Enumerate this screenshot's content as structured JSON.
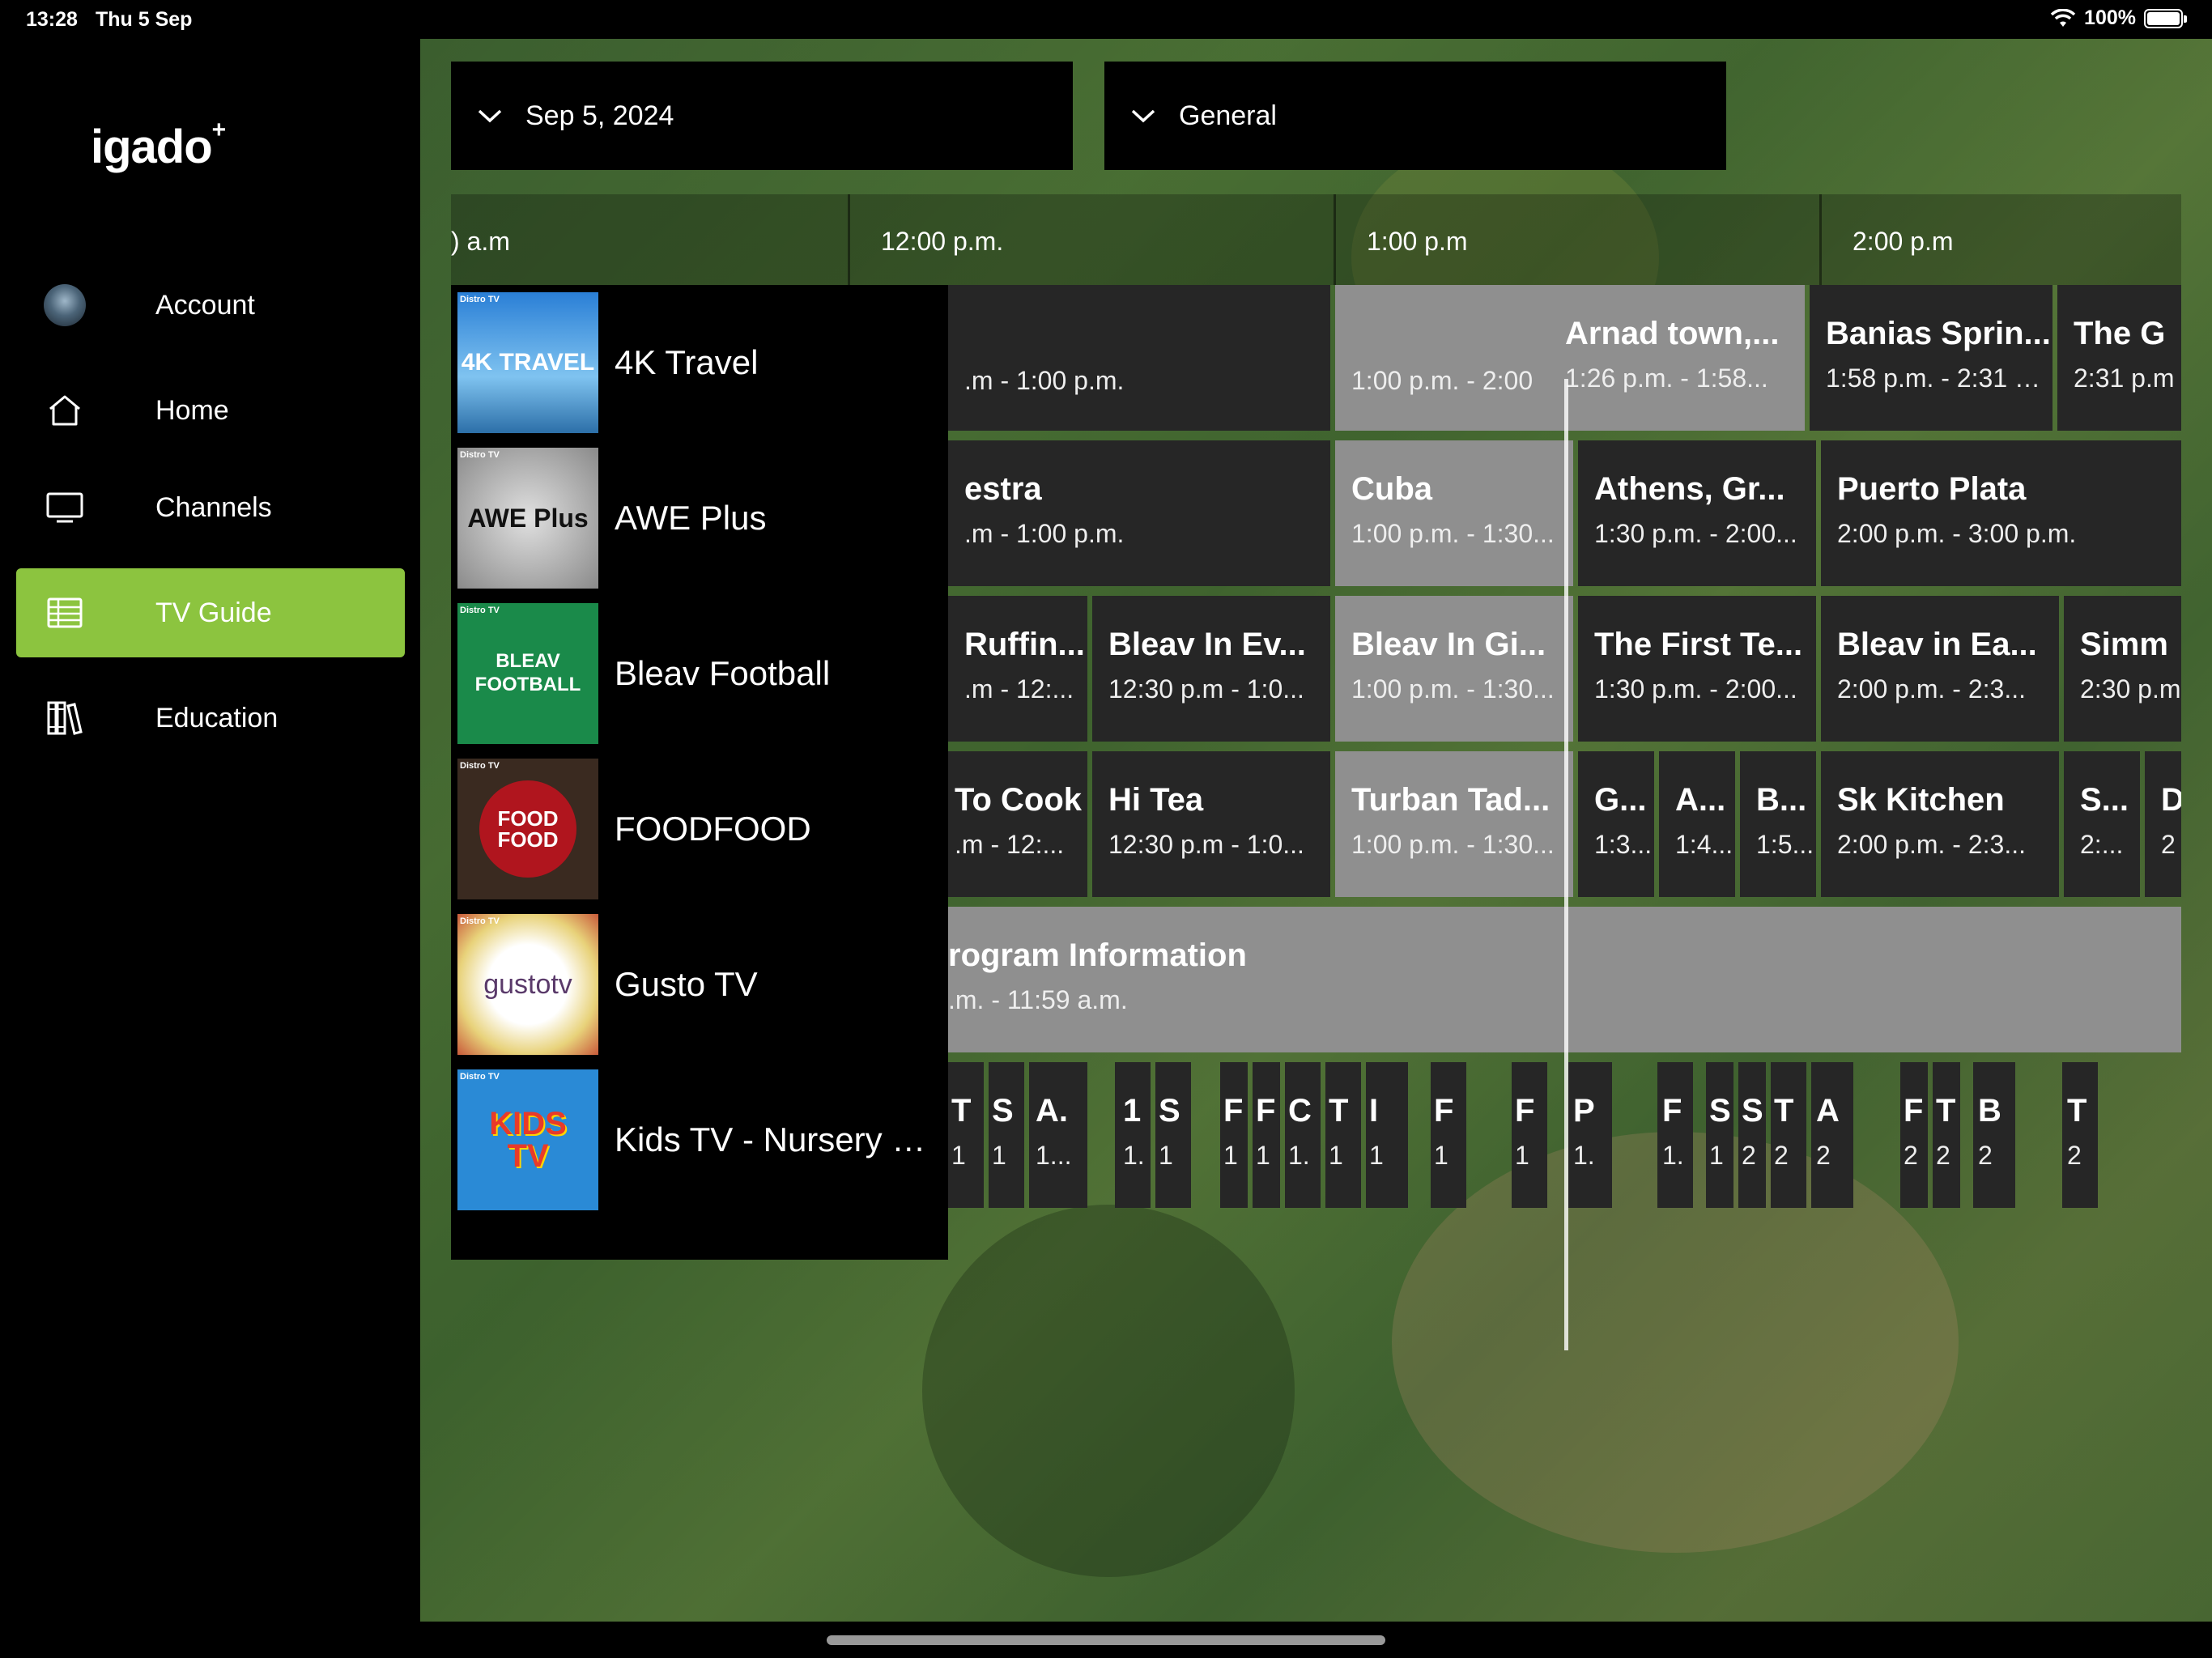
{
  "status": {
    "time": "13:28",
    "date": "Thu 5 Sep",
    "battery": "100%"
  },
  "brand": {
    "logo": "igado",
    "logo_mark": "+"
  },
  "sidebar": {
    "items": [
      {
        "label": "Account",
        "icon": "avatar"
      },
      {
        "label": "Home",
        "icon": "home-icon"
      },
      {
        "label": "Channels",
        "icon": "tv-icon"
      },
      {
        "label": "TV Guide",
        "icon": "grid-guide-icon",
        "active": true
      },
      {
        "label": "Education",
        "icon": "books-icon"
      }
    ]
  },
  "filters": {
    "date": "Sep 5, 2024",
    "category": "General"
  },
  "timeline": {
    "labels": [
      ") a.m",
      "12:00 p.m.",
      "1:00 p.m",
      "2:00 p.m"
    ]
  },
  "channels": [
    {
      "name": "4K Travel",
      "logo_text": "4K TRAVEL",
      "badge": "Distro TV"
    },
    {
      "name": "AWE Plus",
      "logo_text": "AWE Plus",
      "badge": "Distro TV"
    },
    {
      "name": "Bleav Football",
      "logo_text": "BLEAV FOOTBALL",
      "badge": "Distro TV"
    },
    {
      "name": "FOODFOOD",
      "logo_text": "FOOD FOOD",
      "badge": "Distro TV"
    },
    {
      "name": "Gusto TV",
      "logo_text": "gustotv",
      "badge": "Distro TV"
    },
    {
      "name": "Kids TV - Nursery R...",
      "logo_text": "KIDS TV",
      "badge": "Distro TV"
    }
  ],
  "programs": {
    "row0": [
      {
        "title": "",
        "time": ".m - 1:00 p.m."
      },
      {
        "title": "",
        "time": "1:00 p.m. - 2:00"
      },
      {
        "title": "Arnad town,...",
        "time": "1:26 p.m. - 1:58..."
      },
      {
        "title": "Banias Sprin...",
        "time": "1:58 p.m. - 2:31 p...."
      },
      {
        "title": "The G",
        "time": "2:31 p.m"
      }
    ],
    "row1": [
      {
        "title": "estra",
        "time": ".m - 1:00 p.m."
      },
      {
        "title": "Cuba",
        "time": "1:00 p.m. - 1:30..."
      },
      {
        "title": "Athens, Gr...",
        "time": "1:30 p.m. - 2:00..."
      },
      {
        "title": "Puerto Plata",
        "time": "2:00 p.m. - 3:00 p.m."
      }
    ],
    "row2": [
      {
        "title": "Ruffin...",
        "time": ".m - 12:..."
      },
      {
        "title": "Bleav In Ev...",
        "time": "12:30 p.m - 1:0..."
      },
      {
        "title": "Bleav In Gi...",
        "time": "1:00 p.m. - 1:30..."
      },
      {
        "title": "The First Te...",
        "time": "1:30 p.m. - 2:00..."
      },
      {
        "title": "Bleav in Ea...",
        "time": "2:00 p.m. - 2:3..."
      },
      {
        "title": "Simm",
        "time": "2:30 p.m"
      }
    ],
    "row3": [
      {
        "title": "To Cook",
        "time": ".m - 12:..."
      },
      {
        "title": "Hi Tea",
        "time": "12:30 p.m - 1:0..."
      },
      {
        "title": "Turban Tad...",
        "time": "1:00 p.m. - 1:30..."
      },
      {
        "title": "G...",
        "time": "1:3..."
      },
      {
        "title": "A...",
        "time": "1:4..."
      },
      {
        "title": "B...",
        "time": "1:5..."
      },
      {
        "title": "Sk Kitchen",
        "time": "2:00 p.m. - 2:3..."
      },
      {
        "title": "S...",
        "time": "2:..."
      },
      {
        "title": "D",
        "time": "2"
      }
    ],
    "row4": [
      {
        "title": "rogram Information",
        "time": ".m. - 11:59 a.m."
      }
    ],
    "row5": [
      {
        "title": "T",
        "time": "1"
      },
      {
        "title": "S",
        "time": "1"
      },
      {
        "title": "A.",
        "time": "1..."
      },
      {
        "title": "1",
        "time": "1."
      },
      {
        "title": "S",
        "time": "1"
      },
      {
        "title": "F",
        "time": "1"
      },
      {
        "title": "F",
        "time": "1"
      },
      {
        "title": "C",
        "time": "1."
      },
      {
        "title": "T",
        "time": "1"
      },
      {
        "title": "I",
        "time": "1"
      },
      {
        "title": "F",
        "time": "1"
      },
      {
        "title": "F",
        "time": "1"
      },
      {
        "title": "P",
        "time": "1."
      },
      {
        "title": "F",
        "time": "1."
      },
      {
        "title": "S",
        "time": "1"
      },
      {
        "title": "S",
        "time": "2"
      },
      {
        "title": "T",
        "time": "2"
      },
      {
        "title": "A",
        "time": "2"
      },
      {
        "title": "F",
        "time": "2"
      },
      {
        "title": "T",
        "time": "2"
      },
      {
        "title": "B",
        "time": "2"
      },
      {
        "title": "T",
        "time": "2"
      }
    ]
  }
}
